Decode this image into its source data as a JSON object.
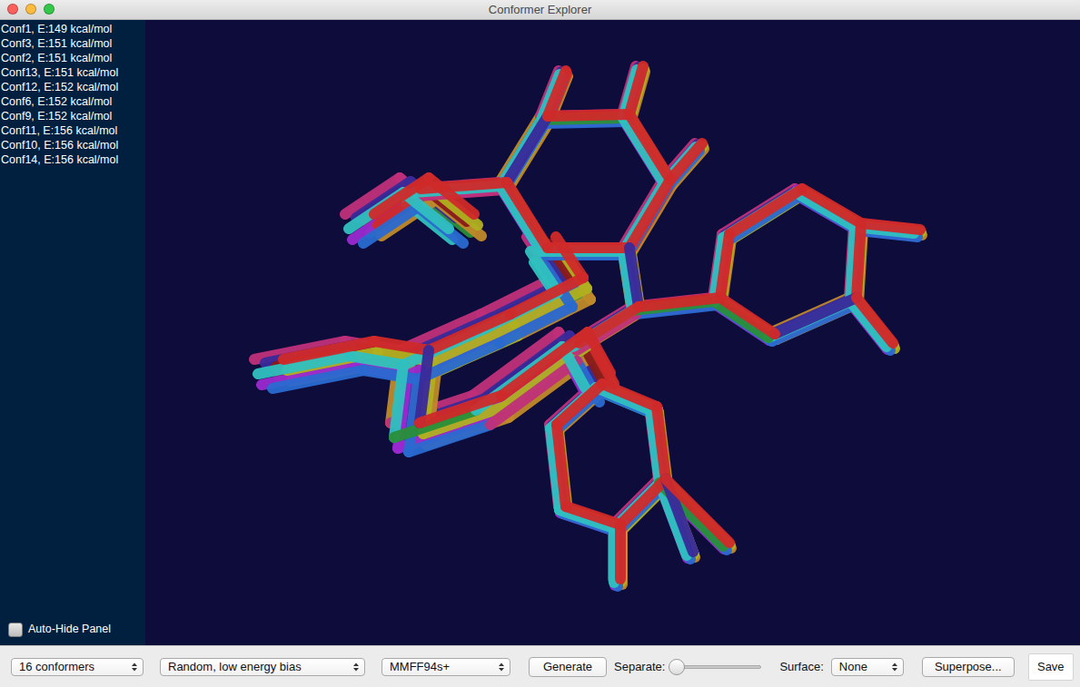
{
  "window": {
    "title": "Conformer Explorer"
  },
  "conformers": [
    {
      "label": "Conf1, E:149 kcal/mol"
    },
    {
      "label": "Conf3, E:151 kcal/mol"
    },
    {
      "label": "Conf2, E:151 kcal/mol"
    },
    {
      "label": "Conf13, E:151 kcal/mol"
    },
    {
      "label": "Conf12, E:152 kcal/mol"
    },
    {
      "label": "Conf6, E:152 kcal/mol"
    },
    {
      "label": "Conf9, E:152 kcal/mol"
    },
    {
      "label": "Conf11, E:156 kcal/mol"
    },
    {
      "label": "Conf10, E:156 kcal/mol"
    },
    {
      "label": "Conf14, E:156 kcal/mol"
    }
  ],
  "auto_hide": {
    "label": "Auto-Hide Panel",
    "checked": false
  },
  "toolbar": {
    "count": "16 conformers",
    "method": "Random, low energy bias",
    "forcefield": "MMFF94s+",
    "generate": "Generate",
    "separate": {
      "label": "Separate:",
      "level": 0
    },
    "surface": {
      "label": "Surface:",
      "value": "None"
    },
    "superpose": "Superpose...",
    "save": "Save"
  }
}
